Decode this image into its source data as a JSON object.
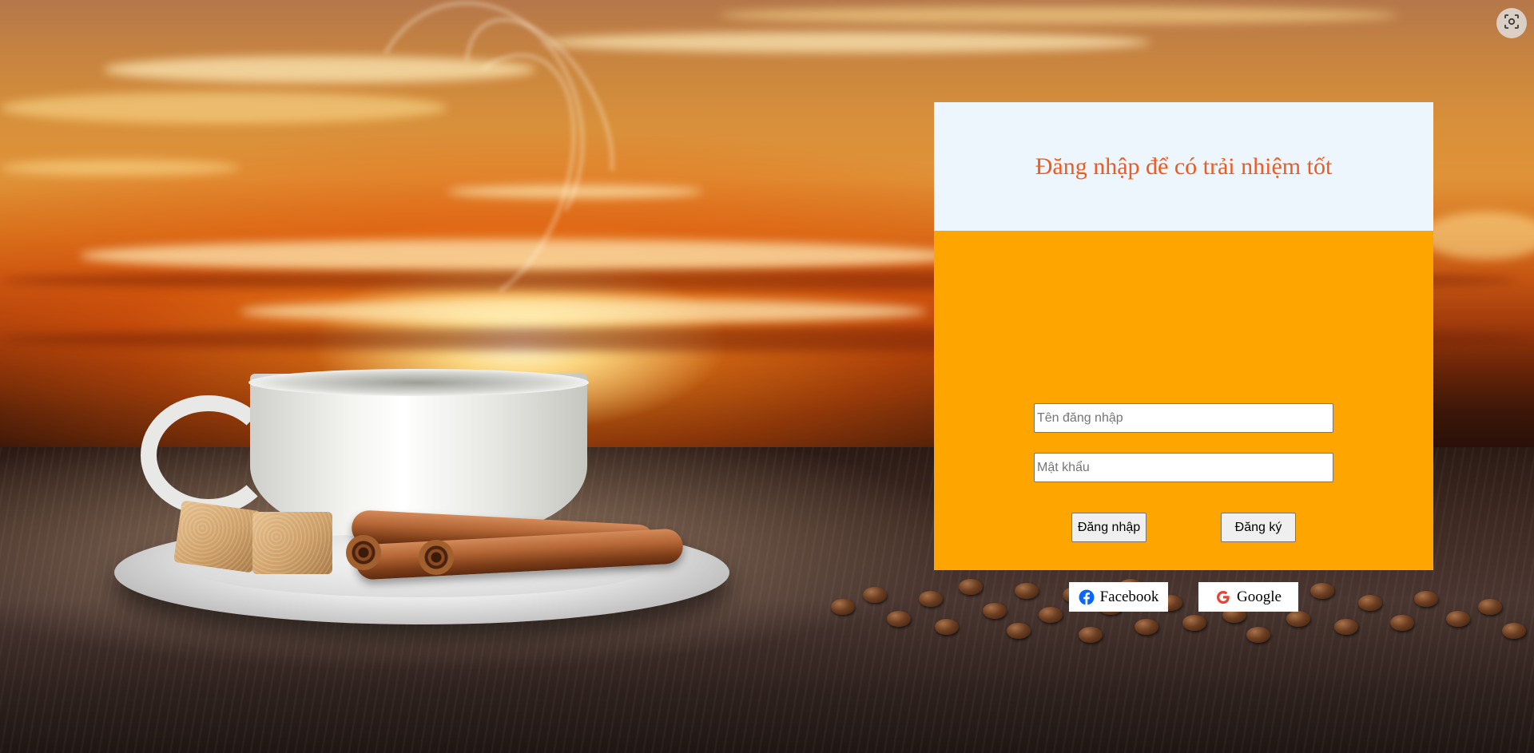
{
  "login": {
    "title": "Đăng nhập để có trải nhiệm tốt",
    "username_placeholder": "Tên đăng nhập",
    "password_placeholder": "Mật khẩu",
    "login_button": "Đăng nhập",
    "register_button": "Đăng ký",
    "facebook_button": "Facebook",
    "google_button": "Google"
  },
  "icons": {
    "capture": "screenshot-capture-icon",
    "facebook": "facebook-icon",
    "google": "google-icon"
  },
  "colors": {
    "title": "#f05a20",
    "header_background": "#edf6fd",
    "body_background": "#ffa500",
    "facebook_blue": "#0866ff",
    "google_red": "#ea4335"
  }
}
